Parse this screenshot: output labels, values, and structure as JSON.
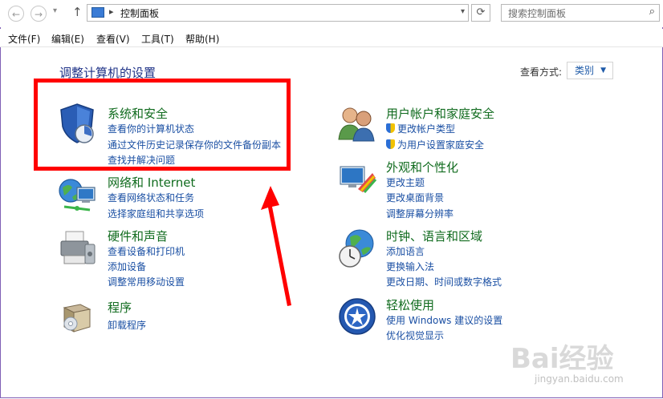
{
  "address": {
    "path": "控制面板",
    "search_placeholder": "搜索控制面板"
  },
  "menu": [
    "文件(F)",
    "编辑(E)",
    "查看(V)",
    "工具(T)",
    "帮助(H)"
  ],
  "page": {
    "heading": "调整计算机的设置",
    "view_by_label": "查看方式:",
    "view_by_value": "类别"
  },
  "categories": [
    {
      "title": "系统和安全",
      "links": [
        "查看你的计算机状态",
        "通过文件历史记录保存你的文件备份副本",
        "查找并解决问题"
      ]
    },
    {
      "title": "网络和 Internet",
      "links": [
        "查看网络状态和任务",
        "选择家庭组和共享选项"
      ]
    },
    {
      "title": "硬件和声音",
      "links": [
        "查看设备和打印机",
        "添加设备",
        "调整常用移动设置"
      ]
    },
    {
      "title": "程序",
      "links": [
        "卸载程序"
      ]
    },
    {
      "title": "用户帐户和家庭安全",
      "links": [
        "更改帐户类型",
        "为用户设置家庭安全"
      ]
    },
    {
      "title": "外观和个性化",
      "links": [
        "更改主题",
        "更改桌面背景",
        "调整屏幕分辨率"
      ]
    },
    {
      "title": "时钟、语言和区域",
      "links": [
        "添加语言",
        "更换输入法",
        "更改日期、时间或数字格式"
      ]
    },
    {
      "title": "轻松使用",
      "links": [
        "使用 Windows 建议的设置",
        "优化视觉显示"
      ]
    }
  ],
  "watermark": {
    "brand": "Bai经验",
    "url": "jingyan.baidu.com"
  },
  "colors": {
    "annotation": "#ff0000",
    "link": "#1a4fa3",
    "category": "#106b1e",
    "heading": "#1e3287"
  }
}
